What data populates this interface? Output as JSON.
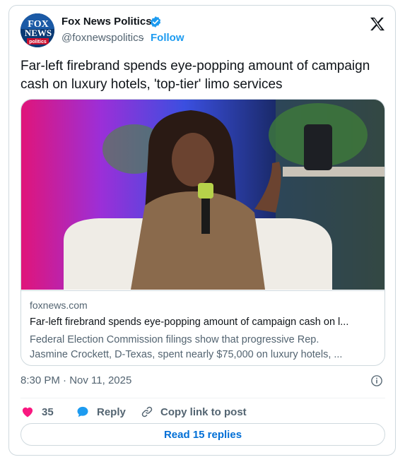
{
  "author": {
    "name": "Fox News Politics",
    "handle": "@foxnewspolitics",
    "separator": "·",
    "follow_label": "Follow",
    "avatar_text": [
      "FOX",
      "NEWS",
      "politics"
    ]
  },
  "post": {
    "text": "Far-left firebrand spends eye-popping amount of campaign cash on luxury hotels, 'top-tier' limo services",
    "timestamp": "8:30 PM · Nov 11, 2025"
  },
  "link_card": {
    "domain": "foxnews.com",
    "title": "Far-left firebrand spends eye-popping amount of campaign cash on l...",
    "description_line1": "Federal Election Commission filings show that progressive Rep.",
    "description_line2": "Jasmine Crockett, D-Texas, spent nearly $75,000 on luxury hotels, ..."
  },
  "actions": {
    "likes_count": "35",
    "reply_label": "Reply",
    "copy_link_label": "Copy link to post"
  },
  "read_replies_label": "Read 15 replies",
  "colors": {
    "accent": "#1d9bf0",
    "like": "#f91880",
    "text_secondary": "#536471",
    "border": "#cfd9de"
  },
  "icons": [
    "verified-badge-icon",
    "x-logo-icon",
    "info-icon",
    "heart-icon",
    "reply-bubble-icon",
    "link-icon"
  ]
}
